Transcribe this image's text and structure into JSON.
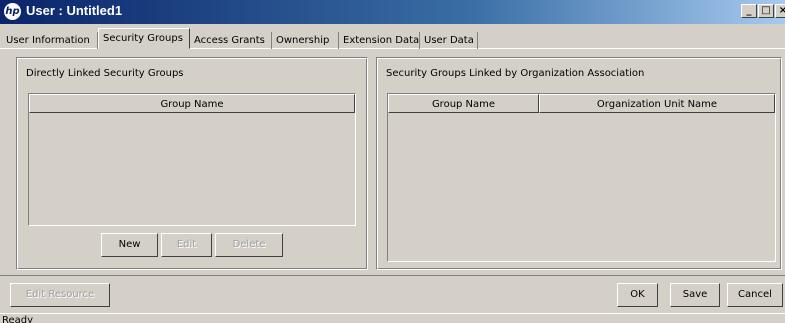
{
  "window": {
    "logo_text": "hp",
    "title": "User : Untitled1",
    "controls": {
      "minimize": "_",
      "maximize": "□",
      "close": "×"
    }
  },
  "tabs": [
    {
      "label": "User Information"
    },
    {
      "label": "Security Groups",
      "active": true
    },
    {
      "label": "Access Grants"
    },
    {
      "label": "Ownership"
    },
    {
      "label": "Extension Data"
    },
    {
      "label": "User Data"
    }
  ],
  "left_panel": {
    "title": "Directly Linked Security Groups",
    "columns": [
      "Group Name"
    ],
    "buttons": {
      "new": "New",
      "edit": "Edit",
      "delete": "Delete"
    }
  },
  "right_panel": {
    "title": "Security Groups Linked by Organization Association",
    "columns": [
      "Group Name",
      "Organization Unit Name"
    ]
  },
  "footer": {
    "edit_resource": "Edit Resource",
    "ok": "OK",
    "save": "Save",
    "cancel": "Cancel"
  },
  "status": "Ready"
}
